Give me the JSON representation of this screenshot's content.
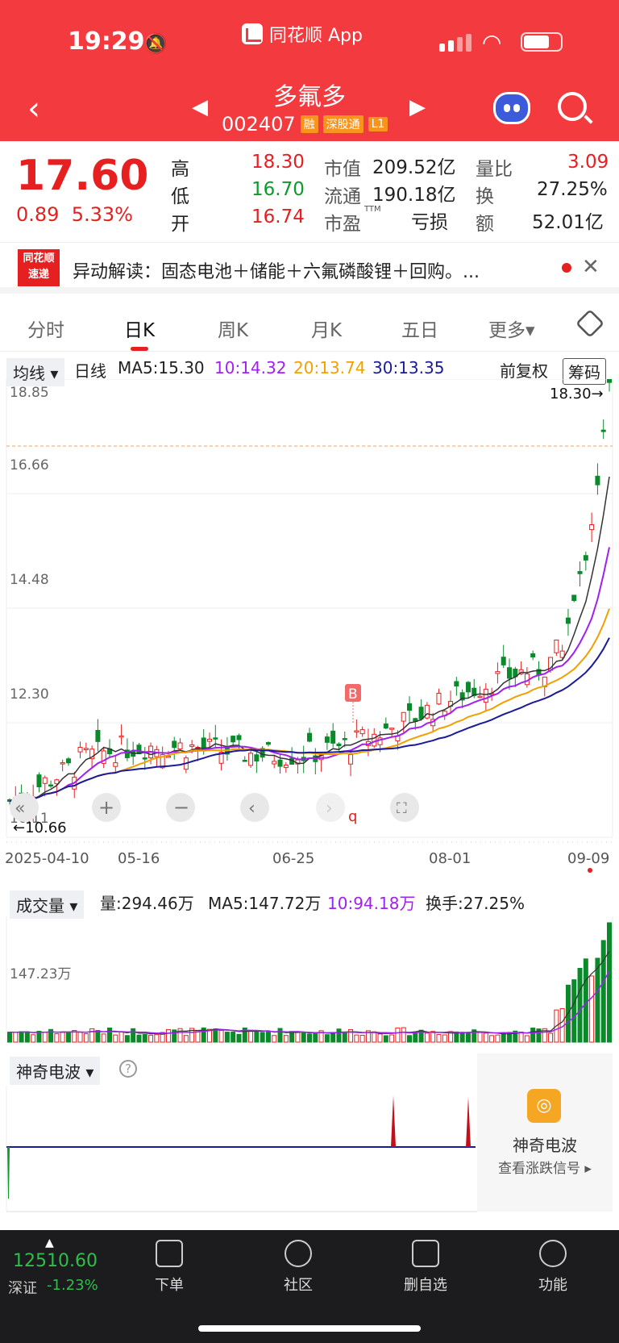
{
  "status": {
    "time": "19:29",
    "app": "同花顺 App"
  },
  "header": {
    "name": "多氟多",
    "code": "002407",
    "tags": [
      "融",
      "深股通",
      "L1"
    ]
  },
  "quote": {
    "price": "17.60",
    "change": "0.89",
    "change_pct": "5.33%",
    "high_label": "高",
    "high": "18.30",
    "low_label": "低",
    "low": "16.70",
    "open_label": "开",
    "open": "16.74",
    "mcap_label": "市值",
    "mcap": "209.52亿",
    "float_label": "流通",
    "float": "190.18亿",
    "pe_label": "市盈",
    "pe_sup": "TTM",
    "pe": "亏损",
    "vr_label": "量比",
    "vr": "3.09",
    "turn_label": "换",
    "turn": "27.25%",
    "amt_label": "额",
    "amt": "52.01亿"
  },
  "news": {
    "logo1": "同花顺",
    "logo2": "速递",
    "text": "异动解读：固态电池＋储能＋六氟磷酸锂＋回购。..."
  },
  "tabs": [
    "分时",
    "日K",
    "周K",
    "月K",
    "五日",
    "更多▾"
  ],
  "ma": {
    "selector": "均线 ▾",
    "period": "日线",
    "ma5": "MA5:15.30",
    "ma10": "10:14.32",
    "ma20": "20:13.74",
    "ma30": "30:13.35",
    "adjust": "前复权",
    "chip": "筹码"
  },
  "chart_labels": {
    "y1": "18.85",
    "y2": "16.66",
    "y3": "14.48",
    "y4": "12.30",
    "y5": "10.11",
    "max_note": "18.30→",
    "min_note": "←10.66",
    "dates": [
      "2025-04-10",
      "05-16",
      "06-25",
      "08-01",
      "09-09"
    ],
    "buy": "B",
    "marker": "q"
  },
  "volume": {
    "selector": "成交量 ▾",
    "vol": "量:294.46万",
    "ma5": "MA5:147.72万",
    "ma10": "10:94.18万",
    "turnover": "换手:27.25%",
    "axis": "147.23万"
  },
  "wave": {
    "selector": "神奇电波 ▾",
    "help": "?",
    "side_title": "神奇电波",
    "side_sub": "查看涨跌信号 ▸"
  },
  "bottom": {
    "index_value": "12510.60",
    "index_name": "深证",
    "index_change": "-1.23%",
    "nav": [
      "下单",
      "社区",
      "删自选",
      "功能"
    ]
  },
  "colors": {
    "red": "#e62020",
    "green": "#0a9c2a",
    "header": "#f23a3f"
  }
}
